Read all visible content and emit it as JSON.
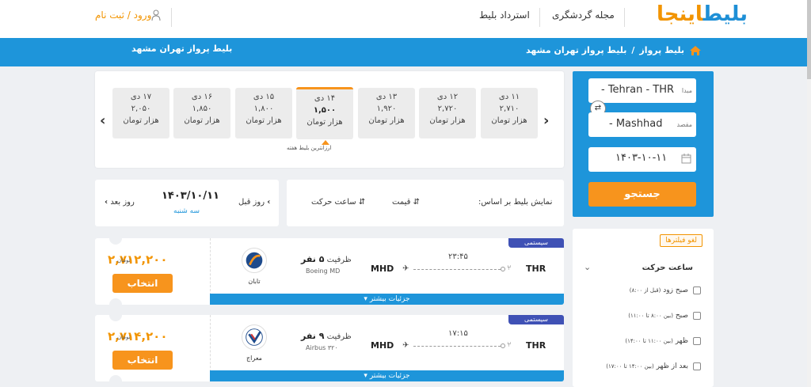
{
  "header": {
    "logo_part1": "بلیط",
    "logo_part2": "اینجا",
    "nav": [
      "مجله گردشگری",
      "استرداد بلیط"
    ],
    "login_text": "ورود / ثبت نام"
  },
  "breadcrumb": {
    "items": [
      "بلیط پرواز",
      "بلیط پرواز تهران مشهد"
    ],
    "separator": "/",
    "page_title": "بلیط پرواز تهران مشهد"
  },
  "search": {
    "origin_label": "مبدا",
    "origin_value": "- Tehran - THR",
    "dest_label": "مقصد",
    "dest_value": "- Mashhad",
    "date_value": "۱۴۰۳-۱۰-۱۱",
    "button": "جستجو"
  },
  "dates": [
    {
      "day": "۱۱ دی",
      "price": "۲,۷۱۰",
      "unit": "هزار تومان"
    },
    {
      "day": "۱۲ دی",
      "price": "۲,۷۲۰",
      "unit": "هزار تومان"
    },
    {
      "day": "۱۳ دی",
      "price": "۱,۹۲۰",
      "unit": "هزار تومان"
    },
    {
      "day": "۱۴ دی",
      "price": "۱,۵۰۰",
      "unit": "هزار تومان"
    },
    {
      "day": "۱۵ دی",
      "price": "۱,۸۰۰",
      "unit": "هزار تومان"
    },
    {
      "day": "۱۶ دی",
      "price": "۱,۸۵۰",
      "unit": "هزار تومان"
    },
    {
      "day": "۱۷ دی",
      "price": "۲,۰۵۰",
      "unit": "هزار تومان"
    }
  ],
  "cheapest_note": "ارزانترین بلیط هفته",
  "day_nav": {
    "prev": "روز قبل",
    "next": "روز بعد",
    "date": "۱۴۰۳/۱۰/۱۱",
    "weekday": "سه شنبه"
  },
  "sort": {
    "label": "نمایش بلیط بر اساس:",
    "price": "قیمت",
    "time": "ساعت حرکت"
  },
  "filters": {
    "clear": "لغو فیلترها",
    "title": "ساعت حرکت",
    "options": [
      {
        "name": "صبح زود",
        "range": "(قبل از ۸:۰۰)"
      },
      {
        "name": "صبح",
        "range": "(بین ۸:۰۰ تا ۱۱:۰۰)"
      },
      {
        "name": "ظهر",
        "range": "(بین ۱۱:۰۰ تا ۱۴:۰۰)"
      },
      {
        "name": "بعد از ظهر",
        "range": "(بین ۱۴:۰۰ تا ۱۷:۰۰)"
      }
    ]
  },
  "flights": [
    {
      "badge": "سیستمی",
      "price": "۲,۷۱۲,۲۰۰",
      "currency": "تومان",
      "select": "انتخاب",
      "airline": "تابان",
      "capacity_label": "ظرفیت",
      "capacity": "۵ نفر",
      "aircraft": "Boeing MD",
      "origin": "THR",
      "destination": "MHD",
      "time": "۲۳:۴۵",
      "details": "جزئیات بیشتر"
    },
    {
      "badge": "سیستمی",
      "price": "۲,۷۱۴,۲۰۰",
      "currency": "تومان",
      "select": "انتخاب",
      "airline": "معراج",
      "capacity_label": "ظرفیت",
      "capacity": "۹ نفر",
      "aircraft": "Airbus ۳۲۰",
      "origin": "THR",
      "destination": "MHD",
      "time": "۱۷:۱۵",
      "details": "جزئیات بیشتر"
    }
  ],
  "colors": {
    "primary_blue": "#1e95da",
    "accent_orange": "#f7941d",
    "badge_indigo": "#3f51b5"
  }
}
